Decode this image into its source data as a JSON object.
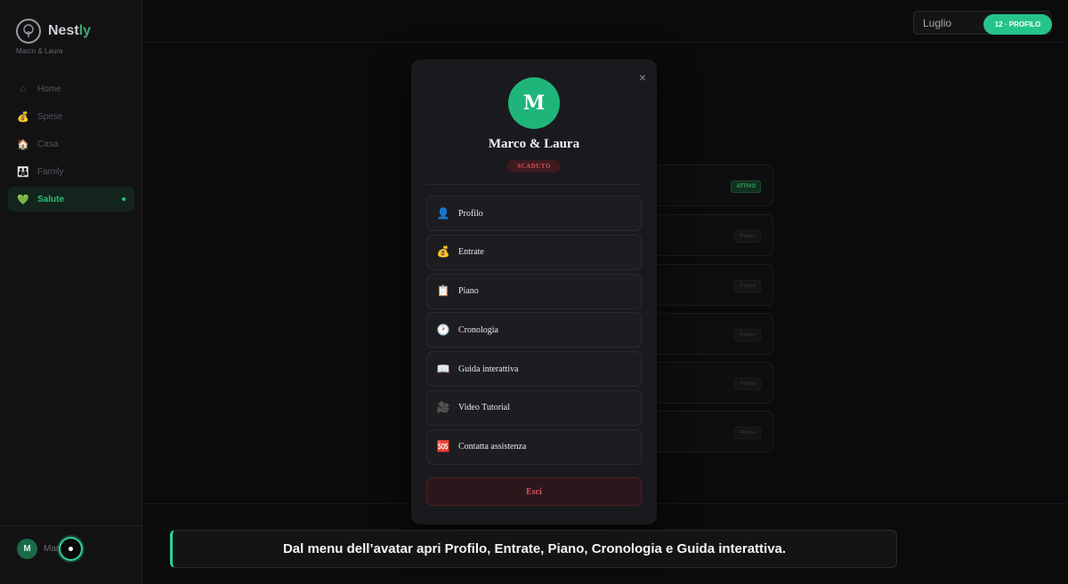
{
  "brand": {
    "name_main": "Nest",
    "name_accent": "ly",
    "subtitle": "Marco & Laura",
    "logo_icon": "tree-icon"
  },
  "sidebar": {
    "items": [
      {
        "label": "Home",
        "icon": "⌂"
      },
      {
        "label": "Spese",
        "icon": "💰"
      },
      {
        "label": "Casa",
        "icon": "🏠"
      },
      {
        "label": "Family",
        "icon": "👪"
      },
      {
        "label": "Salute",
        "icon": "💚"
      }
    ],
    "user_initial": "M",
    "user_name": "Mar"
  },
  "topbar": {
    "month": "Luglio",
    "profile_badge": "12 · PROFILO"
  },
  "background": {
    "status_active": "ATTIVO",
    "status_other": "Pausa"
  },
  "modal": {
    "avatar_initial": "M",
    "name": "Marco & Laura",
    "status": "SCADUTO",
    "close": "×",
    "menu": [
      {
        "label": "Profilo",
        "icon": "👤"
      },
      {
        "label": "Entrate",
        "icon": "💰"
      },
      {
        "label": "Piano",
        "icon": "📋"
      },
      {
        "label": "Cronologia",
        "icon": "🕐"
      },
      {
        "label": "Guida interattiva",
        "icon": "📖"
      },
      {
        "label": "Video Tutorial",
        "icon": "🎥"
      },
      {
        "label": "Contatta assistenza",
        "icon": "🆘"
      }
    ],
    "logout": "Esci"
  },
  "tour": {
    "message": "Dal menu dell’avatar apri Profilo, Entrate, Piano, Cronologia e Guida interattiva."
  },
  "colors": {
    "accent": "#25c48a",
    "danger": "#d8535f",
    "background": "#0b0b0c"
  }
}
